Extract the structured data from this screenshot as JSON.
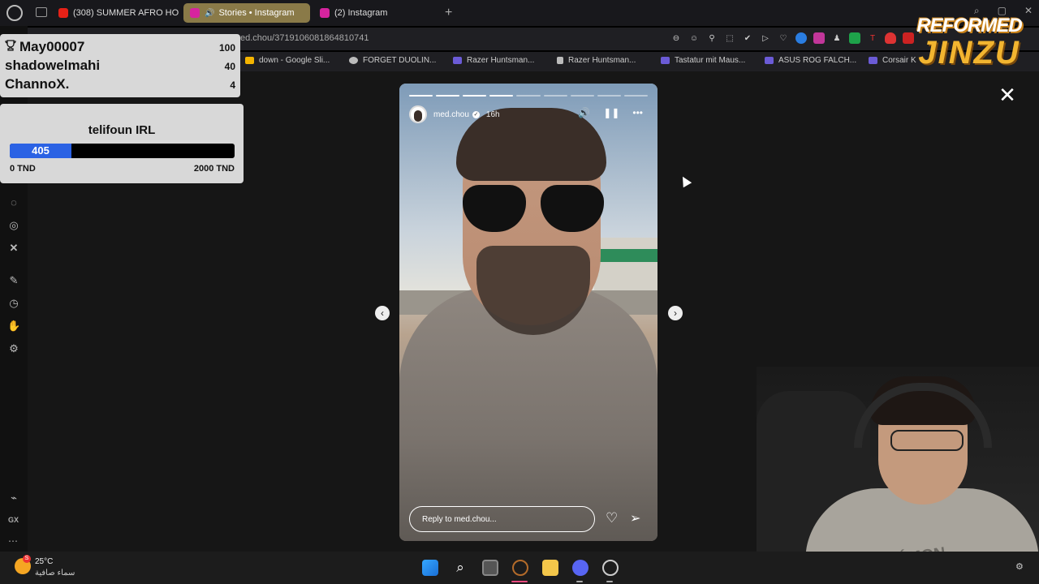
{
  "browser": {
    "tabs": [
      {
        "title": "(308) SUMMER AFRO HO",
        "favicon_color": "#e62117"
      },
      {
        "title": "Stories • Instagram",
        "favicon_color": "#d6249f",
        "active": true
      },
      {
        "title": "(2) Instagram",
        "favicon_color": "#d6249f"
      }
    ],
    "new_tab": "+",
    "url": "ed.chou/3719106081864810741",
    "bookmarks": [
      {
        "label": "down - Google Sli...",
        "icon_color": "#f4b400"
      },
      {
        "label": "FORGET DUOLIN...",
        "icon_color": "#bbb"
      },
      {
        "label": "Razer Huntsman...",
        "icon_color": "#6b5bd6"
      },
      {
        "label": "Razer Huntsman...",
        "icon_color": "#bbb"
      },
      {
        "label": "Tastatur mit Maus...",
        "icon_color": "#6b5bd6"
      },
      {
        "label": "ASUS ROG FALCH...",
        "icon_color": "#6b5bd6"
      },
      {
        "label": "Corsair K",
        "icon_color": "#6b5bd6"
      }
    ]
  },
  "sidebar": {
    "gx_label": "GX",
    "icons": [
      "messenger-icon",
      "instagram-icon",
      "x-icon",
      "paintbrush-icon",
      "clock-icon",
      "extensions-icon",
      "settings-icon"
    ]
  },
  "leaderboard": {
    "rows": [
      {
        "name": "May00007",
        "score": "100"
      },
      {
        "name": "shadowelmahi",
        "score": "40"
      },
      {
        "name": "ChannoX.",
        "score": "4"
      }
    ]
  },
  "donation": {
    "title": "telifoun IRL",
    "current": "405",
    "min_label": "0 TND",
    "max_label": "2000 TND",
    "fraction": 0.2025,
    "fill_color": "#2b62e4"
  },
  "story": {
    "username": "med.chou",
    "time": "16h",
    "reply_placeholder": "Reply to med.chou...",
    "progress_segments": 9,
    "progress_done": 4
  },
  "brand": {
    "top": "REFORMED",
    "bottom": "JINZU"
  },
  "webcam": {
    "shirt_text": "POKÉMON"
  },
  "taskbar": {
    "weather_temp": "25°C",
    "weather_desc": "سماء صافية",
    "weather_badge": "S"
  }
}
